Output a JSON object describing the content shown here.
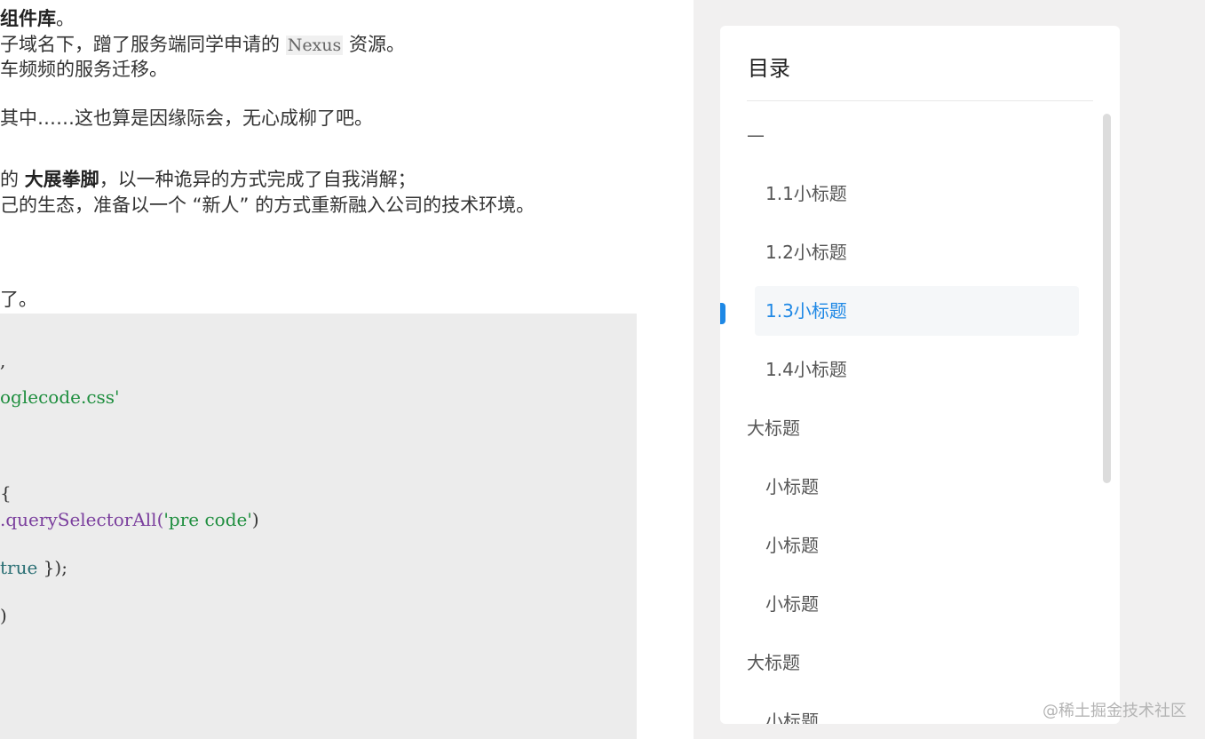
{
  "article": {
    "line1": {
      "bold": "组件库",
      "after": "。"
    },
    "line2": {
      "before": "子域名下，蹭了服务端同学申请的 ",
      "code": "Nexus",
      "after": " 资源。"
    },
    "line3": "车频频的服务迁移。",
    "line4": "其中……这也算是因缘际会，无心成柳了吧。",
    "line5": {
      "before": "的 ",
      "bold": "大展拳脚",
      "after": "，以一种诡异的方式完成了自我消解；"
    },
    "line6": "己的生态，准备以一个 “新人” 的方式重新融入公司的技术环境。",
    "line7": "了。"
  },
  "code": {
    "l1": ",",
    "l2": "oglecode.css'",
    "l3": "{",
    "l4_method": ".querySelectorAll(",
    "l4_arg": "'pre code'",
    "l4_end": ")",
    "l5_kw": "true",
    "l5_end": " });",
    "l6": ")"
  },
  "toc": {
    "title": "目录",
    "items": [
      {
        "label": "—",
        "level": 1,
        "active": false
      },
      {
        "label": "1.1小标题",
        "level": 2,
        "active": false
      },
      {
        "label": "1.2小标题",
        "level": 2,
        "active": false
      },
      {
        "label": "1.3小标题",
        "level": 2,
        "active": true
      },
      {
        "label": "1.4小标题",
        "level": 2,
        "active": false
      },
      {
        "label": "大标题",
        "level": 1,
        "active": false
      },
      {
        "label": "小标题",
        "level": 2,
        "active": false
      },
      {
        "label": "小标题",
        "level": 2,
        "active": false
      },
      {
        "label": "小标题",
        "level": 2,
        "active": false
      },
      {
        "label": "大标题",
        "level": 1,
        "active": false
      },
      {
        "label": "小标题",
        "level": 2,
        "active": false
      }
    ]
  },
  "watermark": "@稀土掘金技术社区",
  "colors": {
    "accent": "#1e88e5",
    "code_background": "#ececec",
    "sidebar_background": "#f1f0f0",
    "string": "#1e8e3e"
  }
}
